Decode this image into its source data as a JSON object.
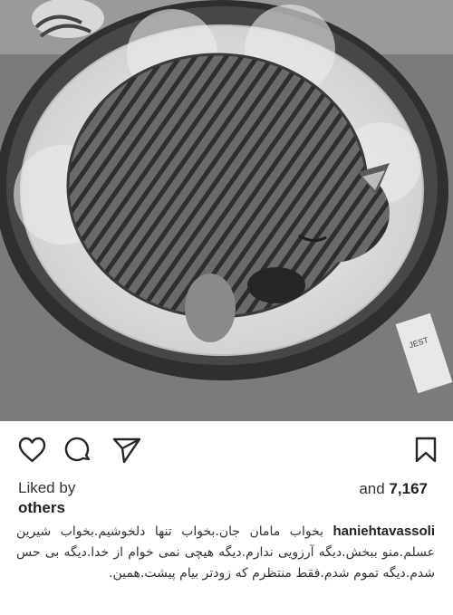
{
  "post": {
    "image": {
      "subject": "photo",
      "tag_text": "JEST"
    },
    "actions": [
      {
        "name": "heart-icon"
      },
      {
        "name": "comment-icon"
      },
      {
        "name": "share-icon"
      },
      {
        "name": "bookmark-icon"
      }
    ],
    "likes": {
      "label": "Liked by",
      "by": "others",
      "and_label": "and",
      "count": "7,167"
    },
    "caption": {
      "username": "haniehtavassoli",
      "text": "بخواب مامان جان.بخواب تنها دلخوشیم.بخواب شیرین عسلم.منو ببخش.دیگه آرزویی ندارم.دیگه هیچی نمی خوام از خدا.دیگه بی حس شدم.دیگه تموم شدم.فقط منتظرم که زودتر بیام پیشت.همین."
    }
  }
}
